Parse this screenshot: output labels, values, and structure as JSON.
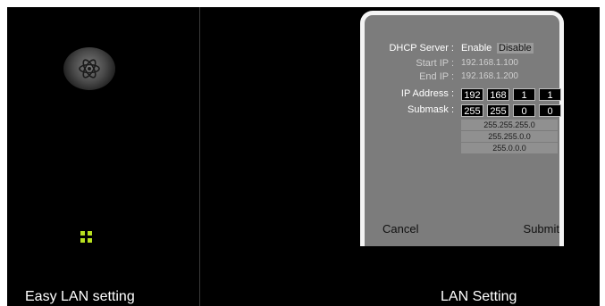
{
  "left_pane": {
    "caption": "Easy LAN setting"
  },
  "right_pane": {
    "caption": "LAN Setting"
  },
  "dialog": {
    "dhcp_label": "DHCP Server :",
    "dhcp_enable": "Enable",
    "dhcp_disable": "Disable",
    "start_ip_label": "Start IP :",
    "start_ip_value": "192.168.1.100",
    "end_ip_label": "End IP :",
    "end_ip_value": "192.168.1.200",
    "ip_label": "IP Address :",
    "ip_octets": [
      "192",
      "168",
      "1",
      "1"
    ],
    "submask_label": "Submask :",
    "submask_octets": [
      "255",
      "255",
      "0",
      "0"
    ],
    "submask_options": [
      "255.255.255.0",
      "255.255.0.0",
      "255.0.0.0"
    ],
    "cancel": "Cancel",
    "submit": "Submit"
  },
  "colors": {
    "accent_green": "#b8e020",
    "panel_bg": "#7c7c7c"
  }
}
